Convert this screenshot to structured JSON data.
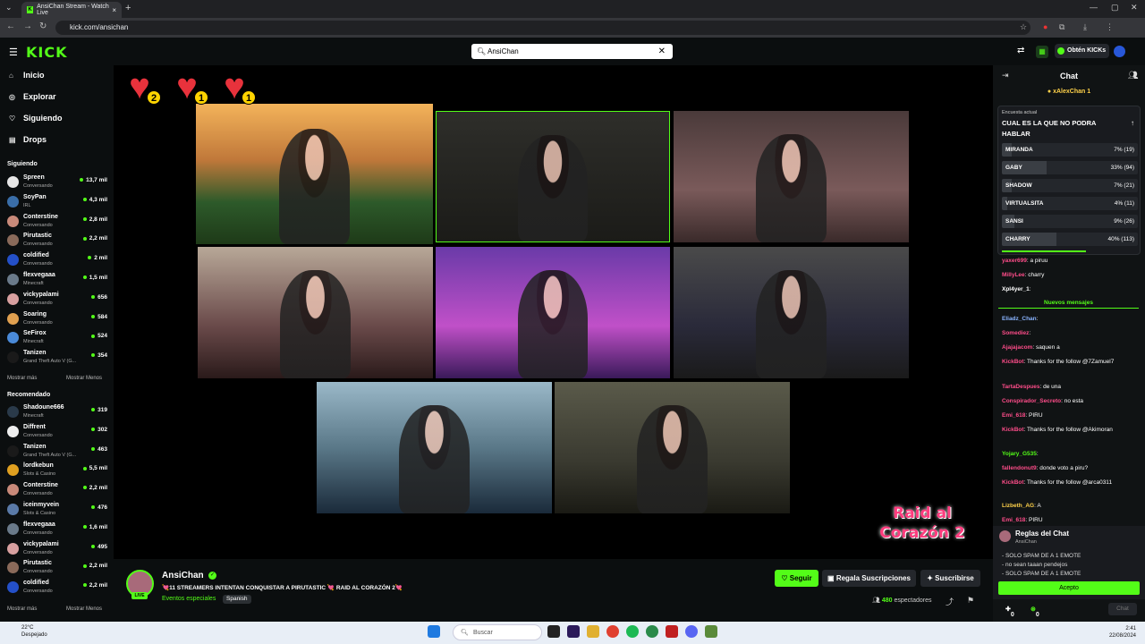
{
  "browser": {
    "tab_title": "AnsiChan Stream - Watch Live",
    "url": "kick.com/ansichan"
  },
  "header": {
    "logo": "KICK",
    "search_value": "AnsiChan",
    "get_kicks": "Obtén KICKs"
  },
  "sidebar": {
    "nav": [
      {
        "label": "Inicio",
        "icon": "home-icon"
      },
      {
        "label": "Explorar",
        "icon": "compass-icon"
      },
      {
        "label": "Siguiendo",
        "icon": "heart-icon"
      },
      {
        "label": "Drops",
        "icon": "gift-icon"
      }
    ],
    "following_title": "Siguiendo",
    "following": [
      {
        "name": "Spreen",
        "cat": "Conversando",
        "viewers": "13,7 mil",
        "color": "#e6e6e6"
      },
      {
        "name": "SoyPan",
        "cat": "IRL",
        "viewers": "4,3 mil",
        "color": "#3a6ea8"
      },
      {
        "name": "Conterstine",
        "cat": "Conversando",
        "viewers": "2,8 mil",
        "color": "#c98a7a"
      },
      {
        "name": "Pirutastic",
        "cat": "Conversando",
        "viewers": "2,2 mil",
        "color": "#8a6a5a"
      },
      {
        "name": "coldified",
        "cat": "Conversando",
        "viewers": "2 mil",
        "color": "#2450c8"
      },
      {
        "name": "flexvegaaa",
        "cat": "Minecraft",
        "viewers": "1,5 mil",
        "color": "#6a7a8a"
      },
      {
        "name": "vickypalami",
        "cat": "Conversando",
        "viewers": "656",
        "color": "#d8a0a0"
      },
      {
        "name": "Soaring",
        "cat": "Conversando",
        "viewers": "584",
        "color": "#e0a050"
      },
      {
        "name": "SeFirox",
        "cat": "Minecraft",
        "viewers": "524",
        "color": "#4a8ad8"
      },
      {
        "name": "Tanizen",
        "cat": "Grand Theft Auto V (G...",
        "viewers": "354",
        "color": "#1a1a1a"
      }
    ],
    "show_more": "Mostrar más",
    "show_less": "Mostrar Menos",
    "recommended_title": "Recomendado",
    "recommended": [
      {
        "name": "Shadoune666",
        "cat": "Minecraft",
        "viewers": "319",
        "color": "#2a3a4a"
      },
      {
        "name": "Diffrent",
        "cat": "Conversando",
        "viewers": "302",
        "color": "#eeeeee"
      },
      {
        "name": "Tanizen",
        "cat": "Grand Theft Auto V (G...",
        "viewers": "463",
        "color": "#1a1a1a"
      },
      {
        "name": "lordkebun",
        "cat": "Slots & Casino",
        "viewers": "5,5 mil",
        "color": "#e0a020"
      },
      {
        "name": "Conterstine",
        "cat": "Conversando",
        "viewers": "2,2 mil",
        "color": "#c98a7a"
      },
      {
        "name": "iceinmyvein",
        "cat": "Slots & Casino",
        "viewers": "476",
        "color": "#5a7aa8"
      },
      {
        "name": "flexvegaaa",
        "cat": "Conversando",
        "viewers": "1,6 mil",
        "color": "#6a7a8a"
      },
      {
        "name": "vickypalami",
        "cat": "Conversando",
        "viewers": "495",
        "color": "#d8a0a0"
      },
      {
        "name": "Pirutastic",
        "cat": "Conversando",
        "viewers": "2,2 mil",
        "color": "#8a6a5a"
      },
      {
        "name": "coldified",
        "cat": "Conversando",
        "viewers": "2,2 mil",
        "color": "#2450c8"
      }
    ]
  },
  "player": {
    "hearts": [
      {
        "badge": "2",
        "color": "#e8323c"
      },
      {
        "badge": "1",
        "color": "#e8323c"
      },
      {
        "badge": "1",
        "color": "#e8323c"
      }
    ],
    "tiles": [
      {
        "bg": "linear-gradient(180deg,#f3b35a 0%,#c0783a 40%,#2d5a2a 70%,#1e3a18 100%)",
        "active": false
      },
      {
        "bg": "linear-gradient(180deg,#2e2e2a 0%,#1b1b18 100%)",
        "active": true
      },
      {
        "bg": "linear-gradient(180deg,#4a3a3a 0%,#7a5a5a 60%,#3a2a2a 100%)",
        "active": false
      },
      {
        "bg": "linear-gradient(180deg,#b8a898 0%,#6a4a4a 60%,#2a1a1a 100%)",
        "active": false
      },
      {
        "bg": "linear-gradient(180deg,#6a3aa8 0%,#c050c8 60%,#3a1a5a 100%)",
        "active": false
      },
      {
        "bg": "linear-gradient(180deg,#4a4a4a 0%,#2a2a3a 60%,#1a1a1a 100%)",
        "active": false
      },
      {
        "bg": "linear-gradient(180deg,#9ab8c8 0%,#5a7888 50%,#1a2a3a 100%)",
        "active": false
      },
      {
        "bg": "linear-gradient(180deg,#5a5a4a 0%,#3a3a30 60%,#1a1a14 100%)",
        "active": false
      }
    ],
    "raid_logo": "Raid al Corazón 2"
  },
  "stream": {
    "channel": "AnsiChan",
    "live": "LIVE",
    "title": "💘11 STREAMERS INTENTAN CONQUISTAR A PIRUTASTIC 💘 RAID AL CORAZÓN 2💘",
    "category": "Eventos especiales",
    "language": "Spanish",
    "follow": "Seguir",
    "gift_subs": "Regala Suscripciones",
    "subscribe": "Suscribirse",
    "viewers_count": "480",
    "viewers_label": "espectadores"
  },
  "chat": {
    "title": "Chat",
    "pinned_user": "xAlexChan",
    "poll": {
      "label": "Encuesta actual",
      "question": "CUAL ES LA QUE NO PODRA HABLAR",
      "options": [
        {
          "name": "MIRANDA",
          "pct": "7% (19)",
          "frac": 0.07
        },
        {
          "name": "GABY",
          "pct": "33% (94)",
          "frac": 0.33
        },
        {
          "name": "SHADOW",
          "pct": "7% (21)",
          "frac": 0.07
        },
        {
          "name": "VIRTUALSITA",
          "pct": "4% (11)",
          "frac": 0.04
        },
        {
          "name": "SANSI",
          "pct": "9% (26)",
          "frac": 0.09
        },
        {
          "name": "CHARRY",
          "pct": "40% (113)",
          "frac": 0.4
        }
      ]
    },
    "new_messages": "Nuevos mensajes",
    "messages": [
      {
        "user": "yaxer699",
        "text": ": a piruu",
        "color": "#ff4d8a"
      },
      {
        "user": "MillyLee",
        "text": ": charry",
        "color": "#ff4d8a"
      },
      {
        "user": "Xpl4yer_1",
        "text": ":",
        "color": "#ffffff"
      },
      {
        "user": "Eliadz_Chan",
        "text": ":",
        "color": "#8ab4ff"
      },
      {
        "user": "Somediez",
        "text": ":",
        "color": "#ff4d8a"
      },
      {
        "user": "Ajajajacom",
        "text": ": saquen a",
        "color": "#ff4d8a"
      },
      {
        "user": "KickBot",
        "text": ": Thanks for the follow @7Zamuel7",
        "color": "#ff4d8a"
      },
      {
        "user": "TartaDespues",
        "text": ": de una",
        "color": "#ff4d8a"
      },
      {
        "user": "Conspirador_Secreto",
        "text": ": no esta",
        "color": "#ff4d8a"
      },
      {
        "user": "Emi_618",
        "text": ": PIRU",
        "color": "#ff4d8a"
      },
      {
        "user": "KickBot",
        "text": ": Thanks for the follow @Akimoran",
        "color": "#ff4d8a"
      },
      {
        "user": "Yojary_G535",
        "text": ":",
        "color": "#53fc18"
      },
      {
        "user": "fallendonut9",
        "text": ": donde voto a piru?",
        "color": "#ff4d8a"
      },
      {
        "user": "KickBot",
        "text": ": Thanks for the follow @arca0311",
        "color": "#ff4d8a"
      },
      {
        "user": "Lizbeth_AG",
        "text": ": A",
        "color": "#ffd24a"
      },
      {
        "user": "Emi_618",
        "text": ": PIRU",
        "color": "#ff4d8a"
      }
    ],
    "rules": {
      "title": "Reglas del Chat",
      "by": "AnsiChan",
      "lines": [
        "- SOLO SPAM DE A 1 EMOTE",
        "- no sean taaan pendejos",
        "- SOLO SPAM DE A 1 EMOTE"
      ],
      "accept": "Acepto"
    },
    "footer": {
      "points": "0",
      "kicks": "0",
      "chat_btn": "Chat"
    }
  },
  "taskbar": {
    "temp": "22°C",
    "weather": "Despejado",
    "search": "Buscar",
    "time": "2:41",
    "date": "22/08/2024"
  }
}
